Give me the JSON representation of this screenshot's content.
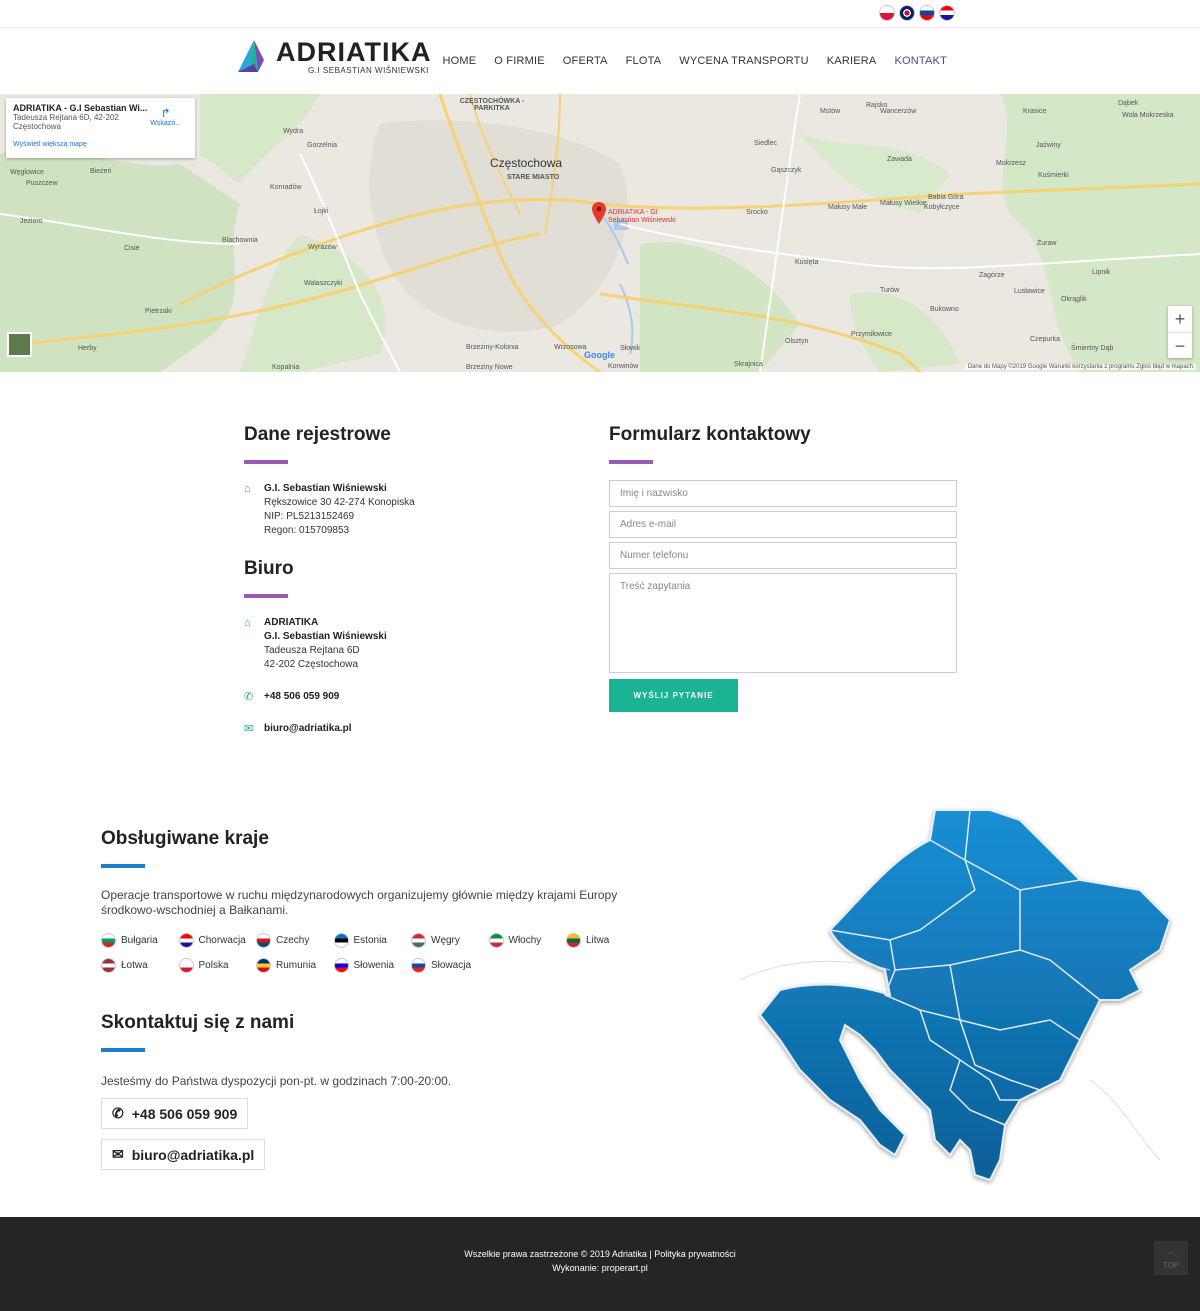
{
  "topbar": {
    "flags": [
      {
        "icon": "poland-flag-icon",
        "c1": "#ffffff",
        "c2": "#dc143c"
      },
      {
        "icon": "uk-flag-icon",
        "c1": "#012169",
        "c2": "#c8102e"
      },
      {
        "icon": "slovenia-flag-icon",
        "c1": "#ffffff",
        "c2": "#0047ab"
      },
      {
        "icon": "croatia-flag-icon",
        "c1": "#ff0000",
        "c2": "#171796"
      }
    ]
  },
  "logo": {
    "name": "ADRIATIKA",
    "sub": "G.I SEBASTIAN WIŚNIEWSKI"
  },
  "nav": {
    "items": [
      {
        "label": "HOME"
      },
      {
        "label": "O FIRMIE"
      },
      {
        "label": "OFERTA"
      },
      {
        "label": "FLOTA"
      },
      {
        "label": "WYCENA TRANSPORTU"
      },
      {
        "label": "KARIERA"
      },
      {
        "label": "KONTAKT",
        "active": true
      }
    ]
  },
  "map": {
    "card_title": "ADRIATIKA - G.I Sebastian Wi...",
    "card_address_1": "Tadeusza Rejtana 6D, 42-202",
    "card_address_2": "Częstochowa",
    "card_directions": "Wskazó...",
    "card_link": "Wyświetl większą mapę",
    "pin_label_1": "ADRIATIKA - GI",
    "pin_label_2": "Sebastian Wiśniewski",
    "city": "Częstochowa",
    "district": "STARE MIASTO",
    "district2": "CZĘSTOCHÓWKA - PARKITKA",
    "zoom_in": "+",
    "zoom_out": "−",
    "attribution": "Dane do Mapy ©2019 Google   Warunki korzystania z programu   Zgłoś błąd w mapach",
    "google": "Google",
    "labels": [
      "Wydra",
      "Gorzelnia",
      "Konradów",
      "Łojki",
      "Blachownia",
      "Wyrazów",
      "Walaszczyki",
      "Pietrzaki",
      "Cisie",
      "Jezioro",
      "Węglowice",
      "Puszczew",
      "Bieżeń",
      "Herby",
      "Mstów",
      "Rajsko",
      "Siedlec",
      "Wancerzów",
      "Gąszczyk",
      "Zawada",
      "Srocko",
      "Małusy Małe",
      "Małusy Wielkie",
      "Babia Góra",
      "Kobyłczyce",
      "Kusięta",
      "Żuraw",
      "Zagórze",
      "Lusławice",
      "Okrąglik",
      "Turów",
      "Bukowno",
      "Przymiłowice",
      "Olsztyn",
      "Skrajnica",
      "Słowik",
      "Korwinów",
      "Wrzosowa",
      "Brzeziny-Kolonia",
      "Brzeziny Nowe",
      "Kopalnia",
      "Krasice",
      "Dąbek",
      "Wola Mokrzeska",
      "Jaźwiny",
      "Mokrzesz",
      "Kuśmierki",
      "Lipnik",
      "Czepurka",
      "Śmiertny Dąb"
    ]
  },
  "reg": {
    "title": "Dane rejestrowe",
    "name": "G.I. Sebastian Wiśniewski",
    "line1": "Rększowice 30 42-274 Konopiska",
    "line2": "NIP: PL5213152469",
    "line3": "Regon: 015709853"
  },
  "office": {
    "title": "Biuro",
    "name1": "ADRIATIKA",
    "name2": "G.I. Sebastian Wiśniewski",
    "line1": "Tadeusza Rejtana 6D",
    "line2": "42-202 Częstochowa",
    "phone": "+48 506 059 909",
    "email": "biuro@adriatika.pl"
  },
  "form": {
    "title": "Formularz kontaktowy",
    "name_ph": "Imię i nazwisko",
    "email_ph": "Adres e-mail",
    "phone_ph": "Numer telefonu",
    "msg_ph": "Treść zapytania",
    "submit": "WYŚLIJ PYTANIE"
  },
  "countries": {
    "title": "Obsługiwane kraje",
    "intro": "Operacje transportowe w ruchu międzynarodowych organizujemy głównie między krajami Europy środkowo-wschodniej a Bałkanami.",
    "list": [
      {
        "name": "Bułgaria",
        "icon": "bulgaria-flag-icon",
        "c1": "#ffffff",
        "c2": "#00966e",
        "c3": "#d62612"
      },
      {
        "name": "Chorwacja",
        "icon": "croatia-flag-icon",
        "c1": "#ff0000",
        "c2": "#ffffff",
        "c3": "#171796"
      },
      {
        "name": "Czechy",
        "icon": "czech-flag-icon",
        "c1": "#ffffff",
        "c2": "#d7141a",
        "c3": "#11457e"
      },
      {
        "name": "Estonia",
        "icon": "estonia-flag-icon",
        "c1": "#0072ce",
        "c2": "#000000",
        "c3": "#ffffff"
      },
      {
        "name": "Węgry",
        "icon": "hungary-flag-icon",
        "c1": "#ce2939",
        "c2": "#ffffff",
        "c3": "#477050"
      },
      {
        "name": "Włochy",
        "icon": "italy-flag-icon",
        "c1": "#009246",
        "c2": "#ffffff",
        "c3": "#ce2b37"
      },
      {
        "name": "Litwa",
        "icon": "lithuania-flag-icon",
        "c1": "#fdb913",
        "c2": "#006a44",
        "c3": "#c1272d"
      },
      {
        "name": "Łotwa",
        "icon": "latvia-flag-icon",
        "c1": "#9e3039",
        "c2": "#ffffff",
        "c3": "#9e3039"
      },
      {
        "name": "Polska",
        "icon": "poland-flag-icon",
        "c1": "#ffffff",
        "c2": "#ffffff",
        "c3": "#dc143c"
      },
      {
        "name": "Rumunia",
        "icon": "romania-flag-icon",
        "c1": "#002b7f",
        "c2": "#fcd116",
        "c3": "#ce1126"
      },
      {
        "name": "Słowenia",
        "icon": "slovenia-flag-icon",
        "c1": "#ffffff",
        "c2": "#0000ff",
        "c3": "#ff0000"
      },
      {
        "name": "Słowacja",
        "icon": "slovakia-flag-icon",
        "c1": "#ffffff",
        "c2": "#0b4ea2",
        "c3": "#ee1c25"
      }
    ]
  },
  "contact_us": {
    "title": "Skontaktuj się z nami",
    "hours": "Jesteśmy do Państwa dyspozycji pon-pt. w godzinach 7:00-20:00.",
    "phone": "+48 506 059 909",
    "email": "biuro@adriatika.pl"
  },
  "footer": {
    "line1": "Wszelkie prawa zastrzeżone © 2019 Adriatika | Polityka prywatności",
    "line2": "Wykonanie: properart.pl",
    "top": "TOP"
  },
  "colors": {
    "accent_purple": "#9b59b6",
    "accent_blue": "#1a7fcb",
    "button_green": "#1ab394",
    "footer": "#252525",
    "map_blue": "#0e6fb0"
  }
}
